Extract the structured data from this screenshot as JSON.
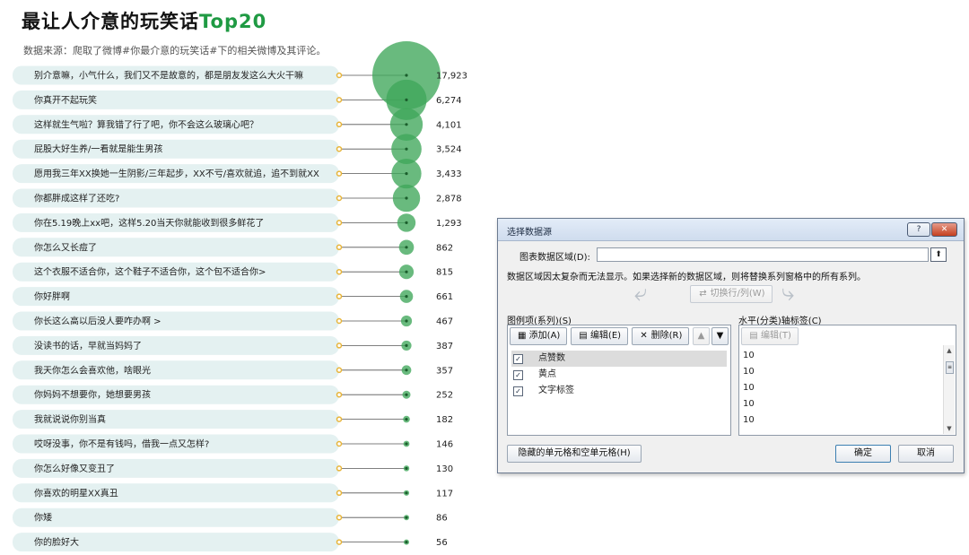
{
  "page": {
    "title_main": "最让人介意的玩笑话",
    "title_accent": "Top20",
    "subtitle": "数据来源：爬取了微博#你最介意的玩笑话#下的相关微博及其评论。"
  },
  "chart_data": {
    "type": "bubble",
    "categories": [
      "别介意嘛，小气什么，我们又不是故意的，都是朋友发这么大火干嘛",
      "你真开不起玩笑",
      "这样就生气啦？算我错了行了吧，你不会这么玻璃心吧？",
      "屁股大好生养/一看就是能生男孩",
      "愿用我三年XX换她一生阴影/三年起步，XX不亏/喜欢就追，追不到就XX",
      "你都胖成这样了还吃?",
      "你在5.19晚上xx吧，这样5.20当天你就能收到很多鲜花了",
      "你怎么又长痘了",
      "这个衣服不适合你，这个鞋子不适合你，这个包不适合你>",
      "你好胖啊",
      "你长这么高以后没人要咋办啊  >",
      "没读书的话，早就当妈妈了",
      "我天你怎么会喜欢他，啥眼光",
      "你妈妈不想要你，她想要男孩",
      "我就说说你别当真",
      "哎呀没事，你不是有钱吗，借我一点又怎样?",
      "你怎么好像又变丑了",
      "你喜欢的明星XX真丑",
      "你矮",
      "你的脸好大"
    ],
    "values": [
      17923,
      6274,
      4101,
      3524,
      3433,
      2878,
      1293,
      862,
      815,
      661,
      467,
      387,
      357,
      252,
      182,
      146,
      130,
      117,
      86,
      56
    ],
    "value_labels": [
      "17,923",
      "6,274",
      "4,101",
      "3,524",
      "3,433",
      "2,878",
      "1,293",
      "862",
      "815",
      "661",
      "467",
      "387",
      "357",
      "252",
      "182",
      "146",
      "130",
      "117",
      "86",
      "56"
    ],
    "colors": {
      "bubble": "#3fa75a",
      "bubble_dark": "#1f9a43",
      "label_bar": "#e4f1f1",
      "dot_left": "#e8b53a",
      "line": "#555555"
    }
  },
  "dialog": {
    "title": "选择数据源",
    "help": "?",
    "close": "✕",
    "range_label": "图表数据区域(D):",
    "range_value": "",
    "message": "数据区域因太复杂而无法显示。如果选择新的数据区域，则将替换系列窗格中的所有系列。",
    "switch_button": "切换行/列(W)",
    "series_header": "图例项(系列)(S)",
    "category_header": "水平(分类)轴标签(C)",
    "add_button": "添加(A)",
    "edit_button": "编辑(E)",
    "delete_button": "删除(R)",
    "cat_edit_button": "编辑(T)",
    "series": [
      {
        "name": "点赞数",
        "checked": true
      },
      {
        "name": "黄点",
        "checked": true
      },
      {
        "name": "文字标签",
        "checked": true
      }
    ],
    "categories": [
      "10",
      "10",
      "10",
      "10",
      "10"
    ],
    "hidden_cells_button": "隐藏的单元格和空单元格(H)",
    "ok_button": "确定",
    "cancel_button": "取消"
  }
}
